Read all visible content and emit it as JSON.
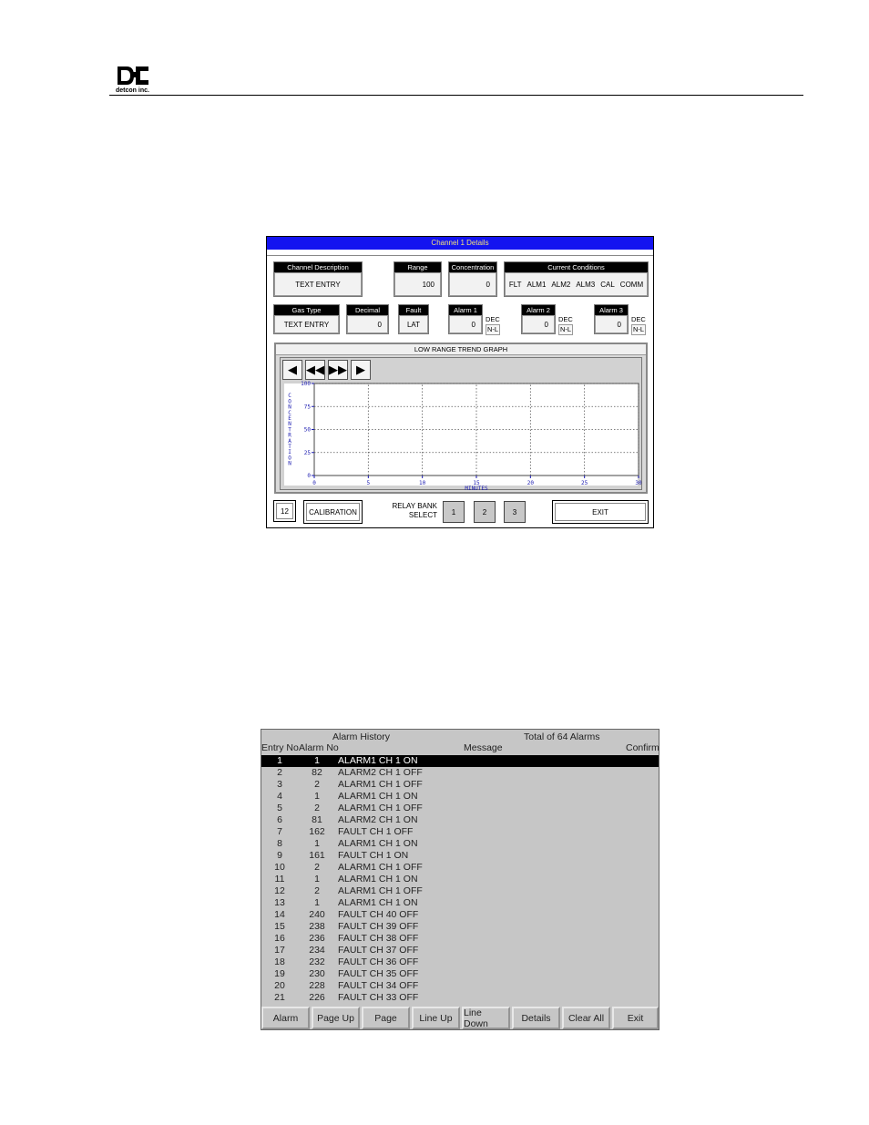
{
  "header": {
    "logo_text": "detcon inc."
  },
  "channel_details": {
    "title": "Channel 1 Details",
    "fields": {
      "channel_description": {
        "label": "Channel Description",
        "value": "TEXT ENTRY"
      },
      "range": {
        "label": "Range",
        "value": "100"
      },
      "concentration": {
        "label": "Concentration",
        "value": "0"
      },
      "current_conditions": {
        "label": "Current Conditions",
        "items": [
          "FLT",
          "ALM1",
          "ALM2",
          "ALM3",
          "CAL",
          "COMM"
        ]
      },
      "gas_type": {
        "label": "Gas Type",
        "value": "TEXT ENTRY"
      },
      "decimal": {
        "label": "Decimal",
        "value": "0"
      },
      "fault": {
        "label": "Fault",
        "value": "LAT"
      },
      "alarm1": {
        "label": "Alarm 1",
        "value": "0",
        "dir": "DEC",
        "latch": "N-L"
      },
      "alarm2": {
        "label": "Alarm 2",
        "value": "0",
        "dir": "DEC",
        "latch": "N-L"
      },
      "alarm3": {
        "label": "Alarm 3",
        "value": "0",
        "dir": "DEC",
        "latch": "N-L"
      }
    },
    "trend": {
      "title": "LOW RANGE TREND GRAPH",
      "nav_buttons": [
        "◀",
        "◀◀",
        "▶▶",
        "▶"
      ]
    },
    "footer": {
      "channel_num": "12",
      "calibration": "CALIBRATION",
      "relay_label_1": "RELAY BANK",
      "relay_label_2": "SELECT",
      "relays": [
        "1",
        "2",
        "3"
      ],
      "exit": "EXIT"
    }
  },
  "chart_data": {
    "type": "line",
    "title": "LOW RANGE TREND GRAPH",
    "xlabel": "MINUTES",
    "ylabel": "CONCENTRATION",
    "xticks": [
      0,
      5,
      10,
      15,
      20,
      25,
      30
    ],
    "yticks": [
      0,
      25,
      50,
      75,
      100
    ],
    "xlim": [
      0,
      30
    ],
    "ylim": [
      0,
      100
    ],
    "grid": true,
    "series": []
  },
  "alarm_history": {
    "title": "Alarm History",
    "total": "Total of 64 Alarms",
    "columns": {
      "entry": "Entry No",
      "alarm": "Alarm No",
      "message": "Message",
      "confirm": "Confirm"
    },
    "rows": [
      {
        "entry": "1",
        "alarm": "1",
        "message": "ALARM1 CH 1 ON"
      },
      {
        "entry": "2",
        "alarm": "82",
        "message": "ALARM2 CH 1 OFF"
      },
      {
        "entry": "3",
        "alarm": "2",
        "message": "ALARM1 CH 1 OFF"
      },
      {
        "entry": "4",
        "alarm": "1",
        "message": "ALARM1 CH 1 ON"
      },
      {
        "entry": "5",
        "alarm": "2",
        "message": "ALARM1 CH 1 OFF"
      },
      {
        "entry": "6",
        "alarm": "81",
        "message": "ALARM2 CH 1 ON"
      },
      {
        "entry": "7",
        "alarm": "162",
        "message": "FAULT CH 1 OFF"
      },
      {
        "entry": "8",
        "alarm": "1",
        "message": "ALARM1 CH 1 ON"
      },
      {
        "entry": "9",
        "alarm": "161",
        "message": "FAULT CH 1 ON"
      },
      {
        "entry": "10",
        "alarm": "2",
        "message": "ALARM1 CH 1 OFF"
      },
      {
        "entry": "11",
        "alarm": "1",
        "message": "ALARM1 CH 1 ON"
      },
      {
        "entry": "12",
        "alarm": "2",
        "message": "ALARM1 CH 1 OFF"
      },
      {
        "entry": "13",
        "alarm": "1",
        "message": "ALARM1 CH 1 ON"
      },
      {
        "entry": "14",
        "alarm": "240",
        "message": "FAULT CH 40 OFF"
      },
      {
        "entry": "15",
        "alarm": "238",
        "message": "FAULT CH 39 OFF"
      },
      {
        "entry": "16",
        "alarm": "236",
        "message": "FAULT CH 38 OFF"
      },
      {
        "entry": "17",
        "alarm": "234",
        "message": "FAULT CH 37 OFF"
      },
      {
        "entry": "18",
        "alarm": "232",
        "message": "FAULT CH 36 OFF"
      },
      {
        "entry": "19",
        "alarm": "230",
        "message": "FAULT CH 35 OFF"
      },
      {
        "entry": "20",
        "alarm": "228",
        "message": "FAULT CH 34 OFF"
      },
      {
        "entry": "21",
        "alarm": "226",
        "message": "FAULT CH 33 OFF"
      }
    ],
    "buttons": [
      "Alarm",
      "Page Up",
      "Page",
      "Line Up",
      "Line Down",
      "Details",
      "Clear All",
      "Exit"
    ]
  }
}
